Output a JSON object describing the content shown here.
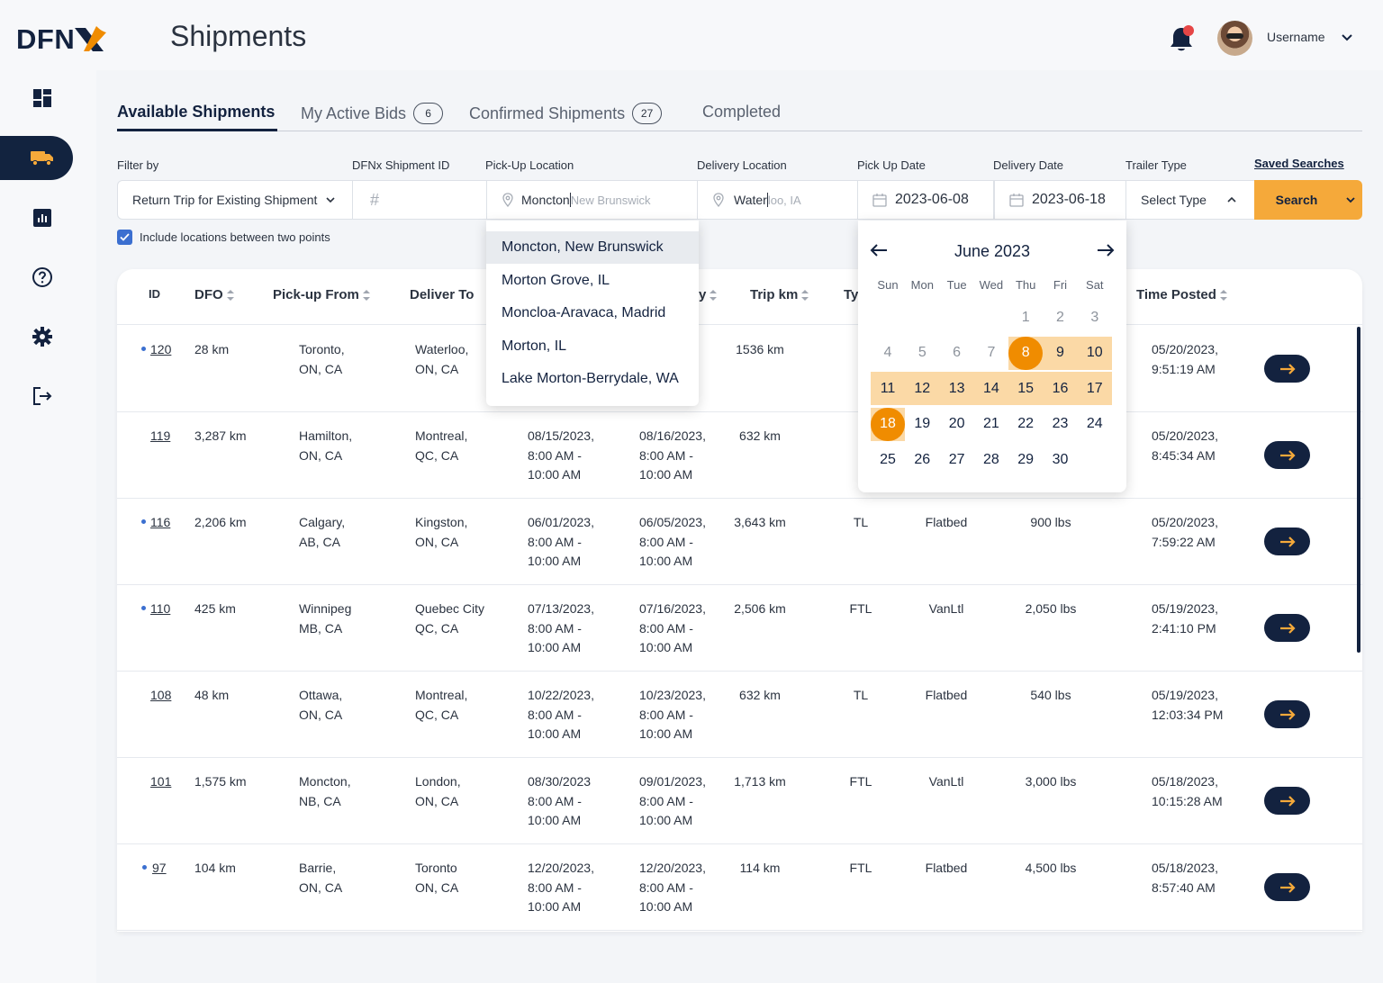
{
  "app": {
    "logo": "DFN",
    "page_title": "Shipments",
    "username": "Username"
  },
  "tabs": [
    {
      "label": "Available Shipments",
      "badge": ""
    },
    {
      "label": "My Active Bids",
      "badge": "6"
    },
    {
      "label": "Confirmed Shipments",
      "badge": "27"
    },
    {
      "label": "Completed",
      "badge": ""
    }
  ],
  "filters": {
    "labels": {
      "filter_by": "Filter by",
      "shipment_id": "DFNx Shipment ID",
      "pickup": "Pick-Up Location",
      "delivery": "Delivery Location",
      "pickup_date": "Pick Up Date",
      "delivery_date": "Delivery Date",
      "trailer": "Trailer Type"
    },
    "saved_searches": "Saved Searches",
    "filter_by_value": "Return Trip for Existing Shipment",
    "shipment_id_placeholder": "#",
    "pickup_typed": "Moncton",
    "pickup_hint": " New Brunswick",
    "delivery_typed": "Water",
    "delivery_hint": "loo, IA",
    "pickup_date": "2023-06-08",
    "delivery_date": "2023-06-18",
    "trailer_value": "Select Type",
    "search_label": "Search",
    "include_between": "Include locations between two points"
  },
  "location_suggestions": [
    "Moncton, New Brunswick",
    "Morton Grove, IL",
    "Moncloa-Aravaca, Madrid",
    "Morton, IL",
    "Lake Morton-Berrydale, WA"
  ],
  "calendar": {
    "title": "June 2023",
    "weekdays": [
      "Sun",
      "Mon",
      "Tue",
      "Wed",
      "Thu",
      "Fri",
      "Sat"
    ],
    "first_weekday": 4,
    "days_in_month": 30,
    "range_start": 8,
    "range_end": 18,
    "accent": "#f08c00",
    "range_color": "#fbd9a6"
  },
  "table": {
    "columns": [
      "ID",
      "DFO",
      "Pick-up From",
      "Deliver To",
      "y",
      "Trip km",
      "Ty",
      "Time Posted"
    ],
    "rows": [
      {
        "id": "120",
        "dot": true,
        "dfo": "28 km",
        "from": "Toronto,\nON, CA",
        "to": "Waterloo,\nON, CA",
        "pickup": "",
        "delivery": "23,",
        "trip": "1536 km",
        "type": "",
        "trailer": "",
        "weight": "",
        "posted": "05/20/2023,\n9:51:19 AM"
      },
      {
        "id": "119",
        "dot": false,
        "dfo": "3,287 km",
        "from": "Hamilton,\nON, CA",
        "to": "Montreal,\nQC, CA",
        "pickup": "08/15/2023,\n8:00 AM -\n10:00 AM",
        "delivery": "08/16/2023,\n8:00 AM -\n10:00 AM",
        "trip": "632 km",
        "type": "",
        "trailer": "",
        "weight": "",
        "posted": "05/20/2023,\n8:45:34 AM"
      },
      {
        "id": "116",
        "dot": true,
        "dfo": "2,206 km",
        "from": "Calgary,\nAB, CA",
        "to": "Kingston,\nON, CA",
        "pickup": "06/01/2023,\n8:00 AM -\n10:00 AM",
        "delivery": "06/05/2023,\n8:00 AM -\n10:00 AM",
        "trip": "3,643 km",
        "type": "TL",
        "trailer": "Flatbed",
        "weight": "900 lbs",
        "posted": "05/20/2023,\n7:59:22 AM"
      },
      {
        "id": "110",
        "dot": true,
        "dfo": "425 km",
        "from": "Winnipeg\nMB, CA",
        "to": "Quebec City\nQC, CA",
        "pickup": "07/13/2023,\n8:00 AM -\n10:00 AM",
        "delivery": "07/16/2023,\n8:00 AM -\n10:00 AM",
        "trip": "2,506 km",
        "type": "FTL",
        "trailer": "VanLtl",
        "weight": "2,050 lbs",
        "posted": "05/19/2023,\n2:41:10 PM"
      },
      {
        "id": "108",
        "dot": false,
        "dfo": "48 km",
        "from": "Ottawa,\nON, CA",
        "to": "Montreal,\nQC, CA",
        "pickup": "10/22/2023,\n8:00 AM -\n10:00 AM",
        "delivery": "10/23/2023,\n8:00 AM -\n10:00 AM",
        "trip": "632 km",
        "type": "TL",
        "trailer": "Flatbed",
        "weight": "540 lbs",
        "posted": "05/19/2023,\n12:03:34 PM"
      },
      {
        "id": "101",
        "dot": false,
        "dfo": "1,575 km",
        "from": "Moncton,\nNB, CA",
        "to": "London,\nON, CA",
        "pickup": "08/30/2023\n8:00 AM -\n10:00 AM",
        "delivery": "09/01/2023,\n8:00 AM -\n10:00 AM",
        "trip": "1,713 km",
        "type": "FTL",
        "trailer": "VanLtl",
        "weight": "3,000 lbs",
        "posted": "05/18/2023,\n10:15:28 AM"
      },
      {
        "id": "97",
        "dot": true,
        "dfo": "104 km",
        "from": "Barrie,\nON, CA",
        "to": "Toronto\nON, CA",
        "pickup": "12/20/2023,\n8:00 AM -\n10:00 AM",
        "delivery": "12/20/2023,\n8:00 AM -\n10:00 AM",
        "trip": "114 km",
        "type": "FTL",
        "trailer": "Flatbed",
        "weight": "4,500 lbs",
        "posted": "05/18/2023,\n8:57:40 AM"
      }
    ]
  },
  "colors": {
    "navy": "#13223f",
    "accent": "#f5a93a",
    "link_dot": "#3b6fd0"
  }
}
